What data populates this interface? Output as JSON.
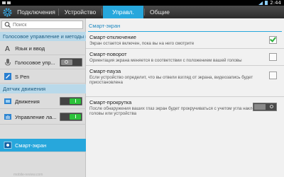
{
  "status": {
    "time": "2:44"
  },
  "tabs": [
    {
      "label": "Подключения",
      "active": false
    },
    {
      "label": "Устройство",
      "active": false
    },
    {
      "label": "Управл.",
      "active": true
    },
    {
      "label": "Общие",
      "active": false
    }
  ],
  "sidebar": {
    "search_placeholder": "Поиск",
    "section_voice": "Голосовое управление и методы в...",
    "items_voice": [
      {
        "label": "Язык и ввод",
        "icon": "keyboard-language-icon"
      },
      {
        "label": "Голосовое упр...",
        "icon": "voice-control-icon",
        "toggle": "off"
      },
      {
        "label": "S Pen",
        "icon": "s-pen-icon"
      }
    ],
    "section_motion": "Датчик движения",
    "items_motion": [
      {
        "label": "Движения",
        "icon": "motion-icon",
        "toggle": "on"
      },
      {
        "label": "Управление ла...",
        "icon": "palm-motion-icon",
        "toggle": "on"
      },
      {
        "label": "Смарт-экран",
        "icon": "smart-screen-icon",
        "selected": true
      }
    ],
    "watermark": "mobile-review.com"
  },
  "main": {
    "title": "Смарт-экран",
    "options": [
      {
        "title": "Смарт-отключение",
        "description": "Экран остается включен, пока вы на него смотрите",
        "control": "checkbox",
        "checked": true
      },
      {
        "title": "Смарт-поворот",
        "description": "Ориентация экрана меняется в соответствии с положением вашей головы",
        "control": "checkbox",
        "checked": false
      },
      {
        "title": "Смарт-пауза",
        "description": "Если устройство определит, что вы отвели взгляд от экрана, видеозапись будет приостановлена",
        "control": "checkbox",
        "checked": false
      },
      {
        "title": "Смарт-прокрутка",
        "description": "После обнаружения ваших глаз экран будет прокручиваться с учетом угла наклона головы или устройства",
        "control": "toggle",
        "checked": false
      }
    ]
  },
  "colors": {
    "accent": "#27a7dc",
    "check_green": "#2cb13a",
    "toggle_on": "#2cc23a"
  }
}
